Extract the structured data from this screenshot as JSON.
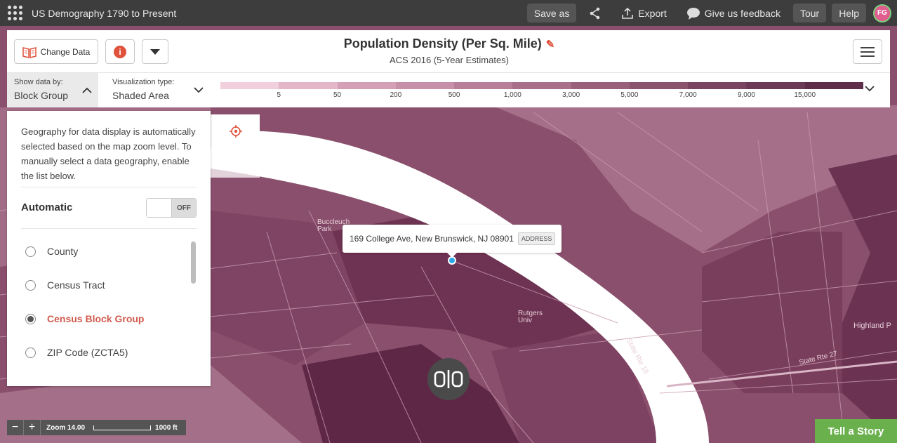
{
  "app": {
    "title": "US Demography 1790 to Present"
  },
  "topbar": {
    "save_as": "Save as",
    "export": "Export",
    "feedback": "Give us feedback",
    "tour": "Tour",
    "help": "Help",
    "avatar_initials": "FG"
  },
  "header": {
    "change_data": "Change Data",
    "info": "i",
    "title": "Population Density (Per Sq. Mile)",
    "subtitle": "ACS 2016 (5-Year Estimates)"
  },
  "controls": {
    "show_by_label": "Show data by:",
    "show_by_value": "Block Group",
    "vis_type_label": "Visualization type:",
    "vis_type_value": "Shaded Area"
  },
  "legend": {
    "labels": [
      "5",
      "50",
      "200",
      "500",
      "1,000",
      "3,000",
      "5,000",
      "7,000",
      "9,000",
      "15,000"
    ],
    "colors": [
      "#f2cfdc",
      "#e3b6c8",
      "#d4a0b6",
      "#c690a8",
      "#b77f98",
      "#a8708a",
      "#99607b",
      "#8a536e",
      "#7a4561",
      "#6c3956",
      "#5d2d4a"
    ]
  },
  "geo_panel": {
    "description": "Geography for data display is automatically selected based on the map zoom level. To manually select a data geography, enable the list below.",
    "automatic_label": "Automatic",
    "toggle_state": "OFF",
    "options": [
      {
        "label": "County",
        "selected": false
      },
      {
        "label": "Census Tract",
        "selected": false
      },
      {
        "label": "Census Block Group",
        "selected": true
      },
      {
        "label": "ZIP Code (ZCTA5)",
        "selected": false
      }
    ]
  },
  "map": {
    "address": "169 College Ave, New Brunswick, NJ 08901",
    "address_tag": "ADDRESS",
    "labels": {
      "buccleuch": "Buccleuch Park",
      "rutgers": "Rutgers Univ",
      "state_rte_18": "State Rte 18",
      "state_rte_27": "State Rte 27",
      "highland": "Highland P"
    },
    "zoom_label": "Zoom 14.00",
    "scale_label": "1000 ft",
    "tell_story": "Tell a Story"
  },
  "colors": {
    "accent": "#e0523c",
    "story_green": "#6ab04c",
    "map_base": "#8e5471"
  }
}
